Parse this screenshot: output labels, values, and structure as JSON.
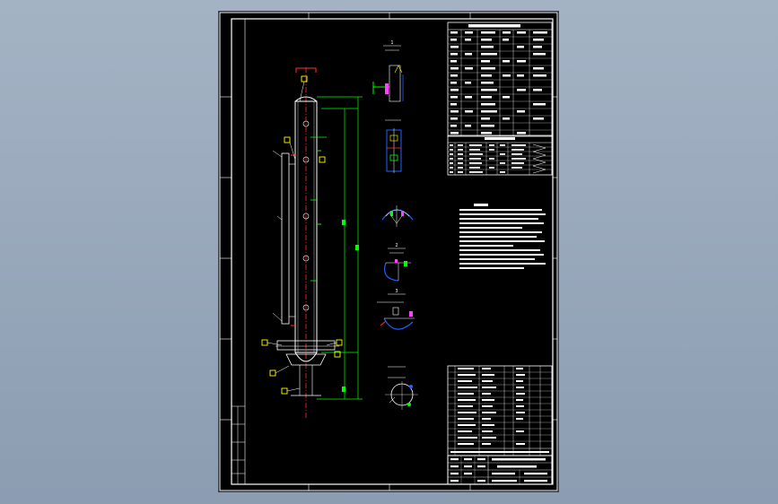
{
  "sheet": {
    "background": "#000000",
    "viewport_background": "#96a5b8"
  },
  "colors": {
    "frame": "#ffffff",
    "dimension": "#00ff00",
    "centerline": "#ff3030",
    "detail": "#2060ff",
    "marker": "#ffff00",
    "hatch": "#ff40ff"
  },
  "views": {
    "detail_1": {
      "number": "1"
    },
    "detail_2": {
      "number": "2"
    },
    "detail_3": {
      "number": "3"
    }
  },
  "icons": {
    "view_markers": "square-marker-icon"
  }
}
